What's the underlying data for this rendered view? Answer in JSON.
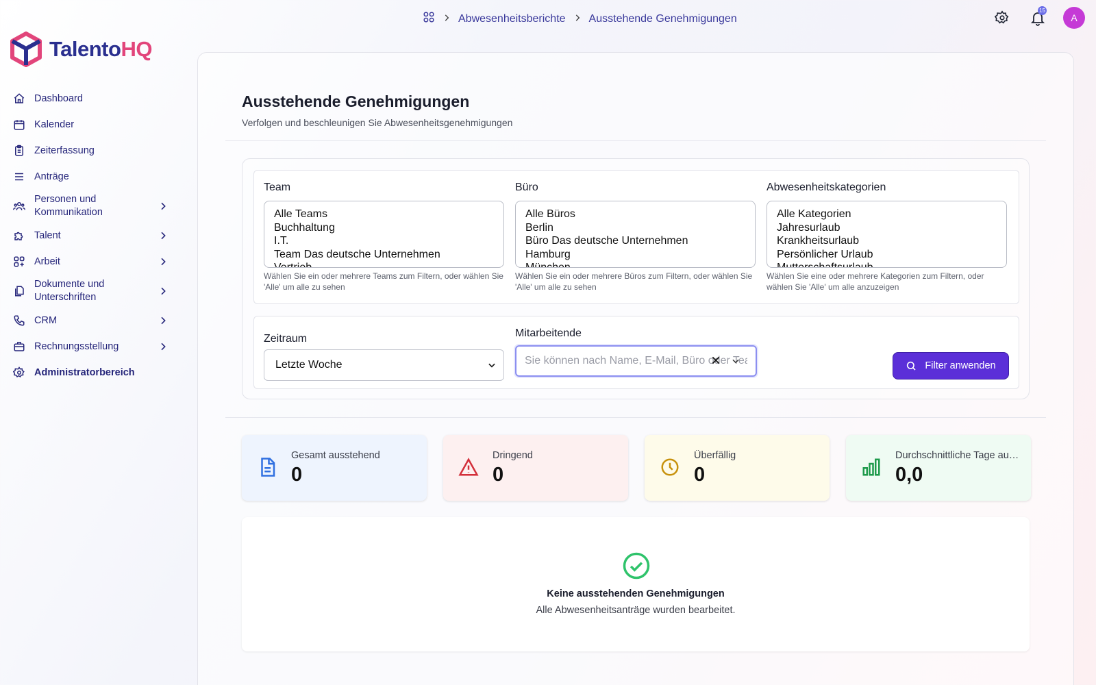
{
  "app": {
    "name_part1": "Talento",
    "name_part2": "HQ"
  },
  "breadcrumb": {
    "items": [
      "Abwesenheitsberichte",
      "Ausstehende Genehmigungen"
    ]
  },
  "header": {
    "notification_count": "15",
    "avatar_initial": "A"
  },
  "sidebar": {
    "items": [
      {
        "label": "Dashboard",
        "icon": "home-icon"
      },
      {
        "label": "Kalender",
        "icon": "calendar-icon"
      },
      {
        "label": "Zeiterfassung",
        "icon": "clipboard-icon"
      },
      {
        "label": "Anträge",
        "icon": "list-icon"
      },
      {
        "label": "Personen und Kommunikation",
        "icon": "users-icon"
      },
      {
        "label": "Talent",
        "icon": "puzzle-icon"
      },
      {
        "label": "Arbeit",
        "icon": "grid-icon"
      },
      {
        "label": "Dokumente und Unterschriften",
        "icon": "documents-icon"
      },
      {
        "label": "CRM",
        "icon": "phone-icon"
      },
      {
        "label": "Rechnungsstellung",
        "icon": "briefcase-icon"
      },
      {
        "label": "Administratorbereich",
        "icon": "gear-icon"
      }
    ]
  },
  "page": {
    "title": "Ausstehende Genehmigungen",
    "subtitle": "Verfolgen und beschleunigen Sie Abwesenheitsgenehmigungen"
  },
  "filters": {
    "team": {
      "label": "Team",
      "options": [
        "Alle Teams",
        "Buchhaltung",
        "I.T.",
        "Team Das deutsche Unternehmen",
        "Vertrieb"
      ],
      "hint": "Wählen Sie ein oder mehrere Teams zum Filtern, oder wählen Sie 'Alle' um alle zu sehen"
    },
    "office": {
      "label": "Büro",
      "options": [
        "Alle Büros",
        "Berlin",
        "Büro Das deutsche Unternehmen",
        "Hamburg",
        "München"
      ],
      "hint": "Wählen Sie ein oder mehrere Büros zum Filtern, oder wählen Sie 'Alle' um alle zu sehen"
    },
    "category": {
      "label": "Abwesenheitskategorien",
      "options": [
        "Alle Kategorien",
        "Jahresurlaub",
        "Krankheitsurlaub",
        "Persönlicher Urlaub",
        "Mutterschaftsurlaub"
      ],
      "hint": "Wählen Sie eine oder mehrere Kategorien zum Filtern, oder wählen Sie 'Alle' um alle anzuzeigen"
    },
    "period": {
      "label": "Zeitraum",
      "value": "Letzte Woche"
    },
    "employees": {
      "label": "Mitarbeitende",
      "placeholder": "Sie können nach Name, E-Mail, Büro oder Team suchen"
    },
    "apply_label": "Filter anwenden"
  },
  "stats": [
    {
      "label": "Gesamt ausstehend",
      "value": "0",
      "icon": "document-icon",
      "bg": "#eef4fe",
      "color": "#2f6fe0"
    },
    {
      "label": "Dringend",
      "value": "0",
      "icon": "warning-icon",
      "bg": "#fdf0f0",
      "color": "#d32f3a"
    },
    {
      "label": "Überfällig",
      "value": "0",
      "icon": "clock-icon",
      "bg": "#fefbea",
      "color": "#c7910c"
    },
    {
      "label": "Durchschnittliche Tage ausstehend",
      "value": "0,0",
      "icon": "bar-chart-icon",
      "bg": "#effbf3",
      "color": "#1e9a4b"
    }
  ],
  "empty_state": {
    "title": "Keine ausstehenden Genehmigungen",
    "subtitle": "Alle Abwesenheitsanträge wurden bearbeitet."
  }
}
